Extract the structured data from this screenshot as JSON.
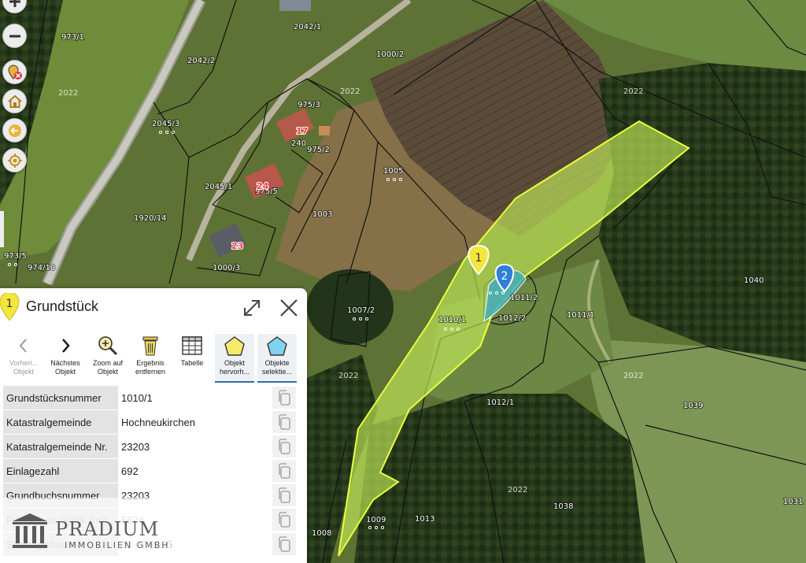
{
  "map": {
    "parcels": [
      {
        "id": "p-973-1",
        "label": "973/1"
      },
      {
        "id": "p-2042-1",
        "label": "2042/1"
      },
      {
        "id": "p-1000-2",
        "label": "1000/2"
      },
      {
        "id": "p-2042-2",
        "label": "2042/2"
      },
      {
        "id": "p-2045-3",
        "label": "2045/3"
      },
      {
        "id": "p-975-3",
        "label": "975/3"
      },
      {
        "id": "p-975-2",
        "label": "975/2"
      },
      {
        "id": "p-240",
        "label": "240"
      },
      {
        "id": "p-975-5",
        "label": "975/5"
      },
      {
        "id": "p-2045-1",
        "label": "2045/1"
      },
      {
        "id": "p-1005",
        "label": "1005"
      },
      {
        "id": "p-1920-14",
        "label": "1920/14"
      },
      {
        "id": "p-1003",
        "label": "1003"
      },
      {
        "id": "p-973-5",
        "label": "973/5"
      },
      {
        "id": "p-974-10",
        "label": "974/10"
      },
      {
        "id": "p-1000-3",
        "label": "1000/3"
      },
      {
        "id": "p-1007-2",
        "label": "1007/2"
      },
      {
        "id": "p-1010-1",
        "label": "1010/1"
      },
      {
        "id": "p-1011-2",
        "label": "1011/2"
      },
      {
        "id": "p-1012-2",
        "label": "1012/2"
      },
      {
        "id": "p-1011-1",
        "label": "1011/1"
      },
      {
        "id": "p-1040",
        "label": "1040"
      },
      {
        "id": "p-1012-1",
        "label": "1012/1"
      },
      {
        "id": "p-1039",
        "label": "1039"
      },
      {
        "id": "p-1038",
        "label": "1038"
      },
      {
        "id": "p-1031",
        "label": "1031"
      },
      {
        "id": "p-1013",
        "label": "1013"
      },
      {
        "id": "p-1009",
        "label": "1009"
      },
      {
        "id": "p-1008",
        "label": "1008"
      }
    ],
    "zones": [
      "2022",
      "2022",
      "2022",
      "2022",
      "2022",
      "2022"
    ],
    "house_numbers": [
      "17",
      "24",
      "23"
    ],
    "markers": [
      "1",
      "2"
    ],
    "colors": {
      "selection_fill": "#c8f25a",
      "selection_stroke": "#e9ff3c",
      "highlight_fill": "#35a7c9",
      "marker_yellow": "#f3e63a",
      "marker_blue": "#2f7fd6"
    }
  },
  "controls": [
    {
      "name": "zoom-in-button",
      "icon": "plus-icon"
    },
    {
      "name": "zoom-out-button",
      "icon": "minus-icon"
    },
    {
      "name": "remove-marker-button",
      "icon": "pin-remove-icon"
    },
    {
      "name": "home-button",
      "icon": "home-icon"
    },
    {
      "name": "back-button",
      "icon": "arrow-left-icon"
    },
    {
      "name": "locate-button",
      "icon": "crosshair-icon"
    }
  ],
  "panel": {
    "marker": "1",
    "title": "Grundstück",
    "toolbar": [
      {
        "name": "previous-object-button",
        "icon": "chevron-left-icon",
        "label": "Vorheri... Objekt",
        "disabled": true
      },
      {
        "name": "next-object-button",
        "icon": "chevron-right-icon",
        "label": "Nächstes Objekt",
        "disabled": false
      },
      {
        "name": "zoom-to-object-button",
        "icon": "zoom-in-icon",
        "label": "Zoom auf Objekt",
        "disabled": false
      },
      {
        "name": "remove-result-button",
        "icon": "trash-icon",
        "label": "Ergebnis entfernen",
        "disabled": false
      },
      {
        "name": "table-button",
        "icon": "table-icon",
        "label": "Tabelle",
        "disabled": false
      },
      {
        "name": "highlight-object-button",
        "icon": "pentagon-yellow-icon",
        "label": "Objekt hervorh...",
        "disabled": false
      },
      {
        "name": "select-object-button",
        "icon": "pentagon-blue-icon",
        "label": "Objekte selektie...",
        "disabled": false
      }
    ],
    "attributes": [
      {
        "key": "Grundstücksnummer",
        "value": "1010/1"
      },
      {
        "key": "Katastralgemeinde",
        "value": "Hochneukirchen"
      },
      {
        "key": "Katastralgemeinde Nr.",
        "value": "23203"
      },
      {
        "key": "Einlagezahl",
        "value": "692"
      },
      {
        "key": "Grundbuchsnummer",
        "value": "23203"
      },
      {
        "key": "Fläche aus Grafik [m²]",
        "value": "5624"
      },
      {
        "key": "Stichtagsdatum",
        "value": "01.07.2025"
      }
    ]
  },
  "watermark": {
    "brand": "PRADIUM",
    "sub": "IMMOBILIEN GMBH"
  }
}
